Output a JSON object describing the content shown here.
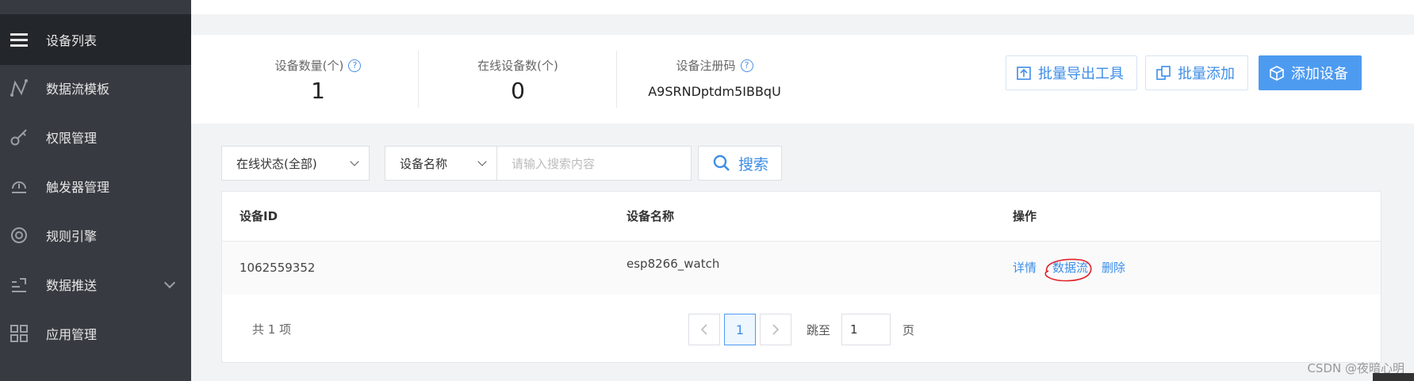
{
  "sidebar": {
    "items": [
      {
        "label": "设备列表",
        "icon": "menu-icon",
        "active": true
      },
      {
        "label": "数据流模板",
        "icon": "data-stream-icon"
      },
      {
        "label": "权限管理",
        "icon": "key-icon"
      },
      {
        "label": "触发器管理",
        "icon": "trigger-icon"
      },
      {
        "label": "规则引擎",
        "icon": "target-icon"
      },
      {
        "label": "数据推送",
        "icon": "push-icon",
        "expandable": true
      },
      {
        "label": "应用管理",
        "icon": "grid-icon"
      }
    ]
  },
  "stats": {
    "device_count_label": "设备数量(个)",
    "device_count": "1",
    "online_count_label": "在线设备数(个)",
    "online_count": "0",
    "reg_code_label": "设备注册码",
    "reg_code": "A9SRNDptdm5IBBqU"
  },
  "actions": {
    "export_label": "批量导出工具",
    "batch_add_label": "批量添加",
    "add_device_label": "添加设备"
  },
  "filters": {
    "status_select": "在线状态(全部)",
    "field_select": "设备名称",
    "search_placeholder": "请输入搜索内容",
    "search_label": "搜索"
  },
  "table": {
    "headers": [
      "设备ID",
      "设备名称",
      "操作"
    ],
    "rows": [
      {
        "id": "1062559352",
        "name": "esp8266_watch",
        "ops": [
          "详情",
          "数据流",
          "删除"
        ]
      }
    ]
  },
  "pagination": {
    "total": "共 1 项",
    "current_page": "1",
    "jump_label": "跳至",
    "jump_value": "1",
    "page_suffix": "页"
  },
  "watermark": "CSDN @夜暗心明",
  "colors": {
    "accent": "#3d8ee8",
    "primary_button": "#4d9bf1",
    "sidebar": "#373b41",
    "annotation": "#e0202a"
  }
}
